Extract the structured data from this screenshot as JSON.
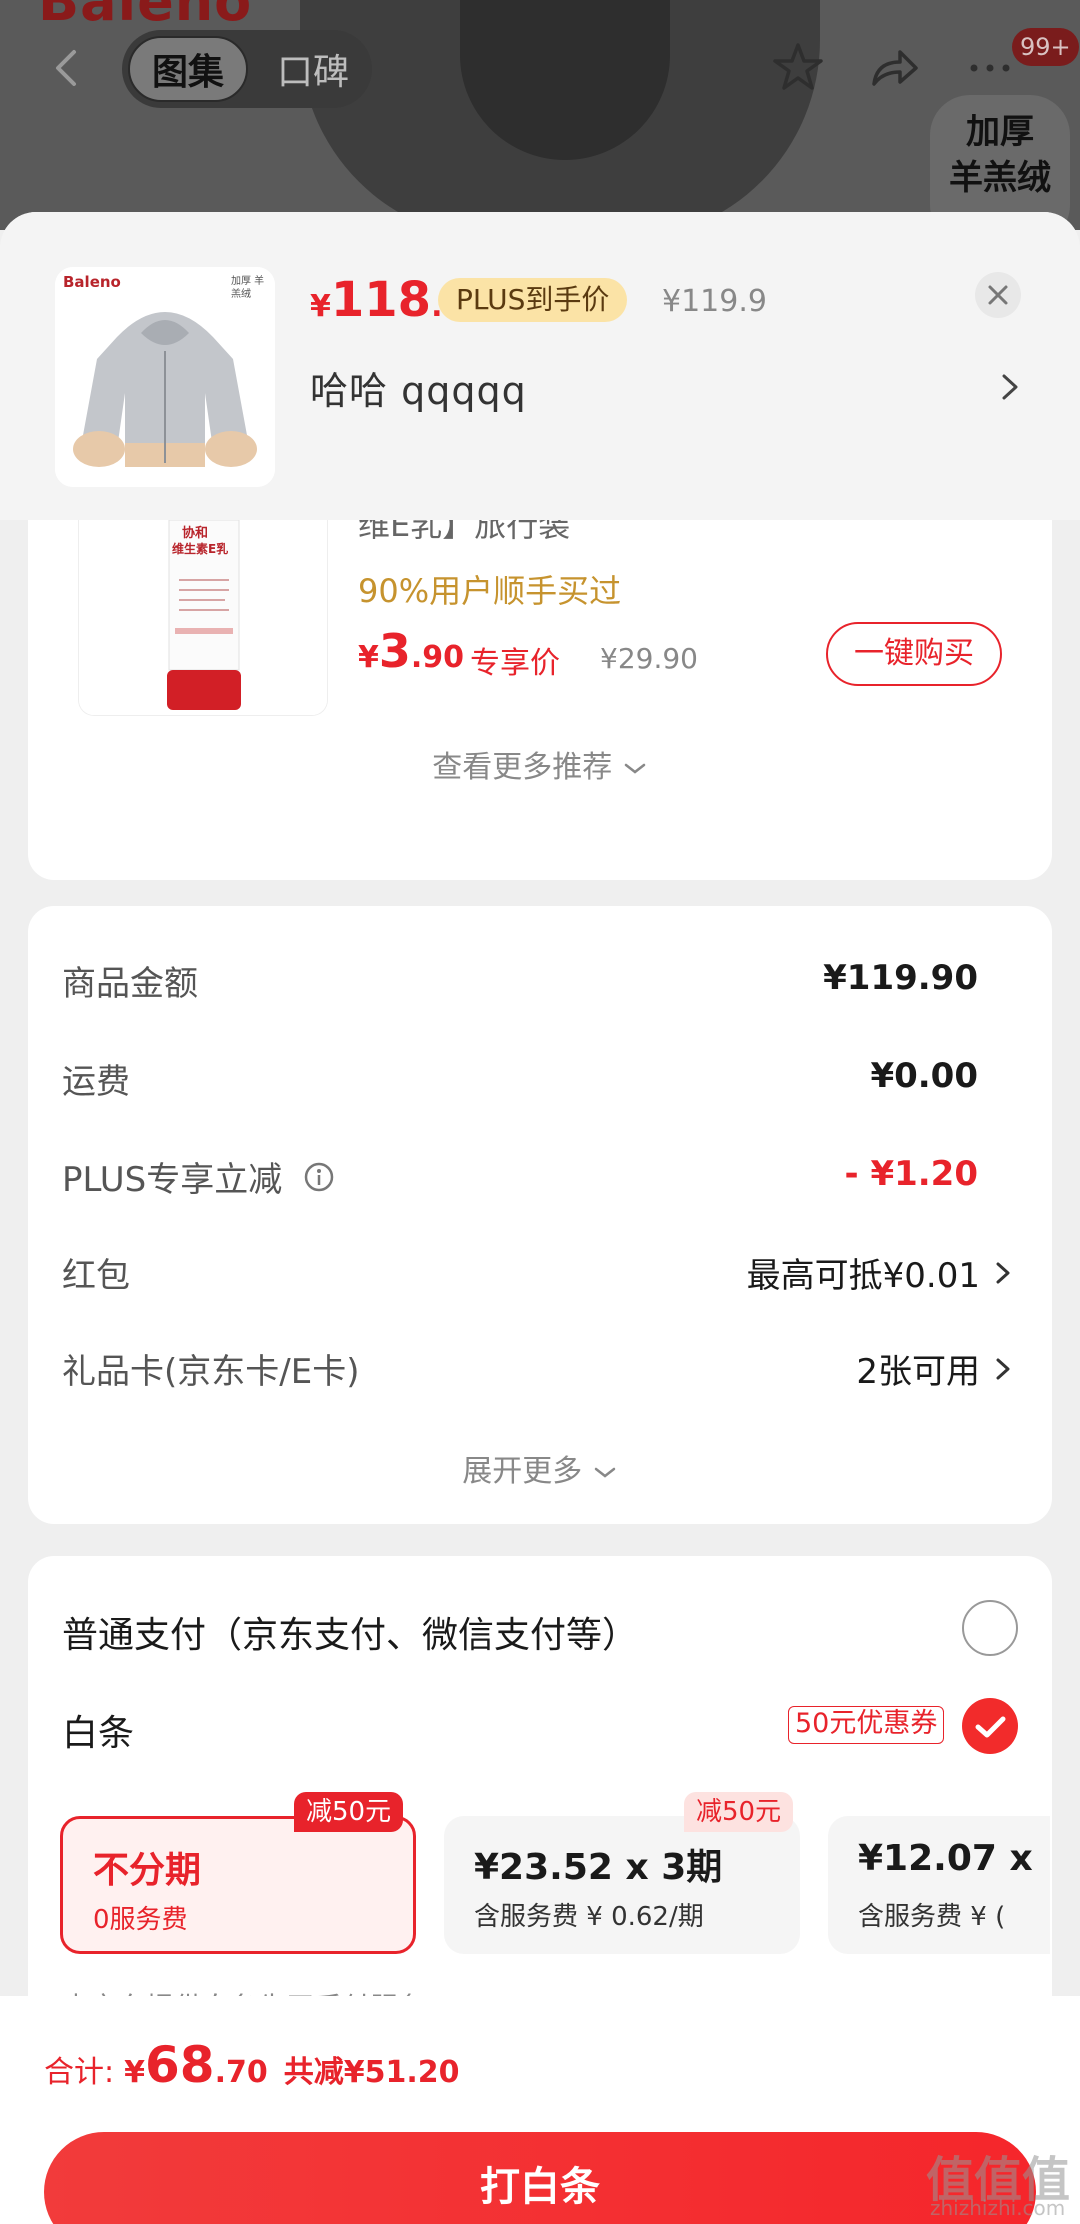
{
  "top_bar": {
    "brand_text": "Baleno",
    "tab_gallery": "图集",
    "tab_reviews": "口碑",
    "badge_count": "99+",
    "promo_line1": "加厚",
    "promo_line2": "羊羔绒"
  },
  "product": {
    "thumb_brand": "Baleno",
    "thumb_tag": "加厚 羊羔绒",
    "price_symbol": "¥",
    "price_int": "118",
    "price_dec": ".7",
    "plus_label": "PLUS到手价",
    "original_price": "¥119.9",
    "sku": "哈哈   qqqqq"
  },
  "recommend": {
    "title": "维E乳】旅行装",
    "stat": "90%用户顺手买过",
    "price_symbol": "¥",
    "price_int": "3",
    "price_dec": ".90",
    "price_label": "专享价",
    "original_price": "¥29.90",
    "buy_label": "一键购买",
    "more_label": "查看更多推荐",
    "tube_brand": "协和",
    "tube_name": "维生素E乳"
  },
  "costs": {
    "rows": [
      {
        "label": "商品金额",
        "value": "¥119.90"
      },
      {
        "label": "运费",
        "value": "¥0.00"
      },
      {
        "label": "PLUS专享立减",
        "value": "- ¥1.20"
      }
    ],
    "hongbao_label": "红包",
    "hongbao_value": "最高可抵¥0.01",
    "giftcard_label": "礼品卡(京东卡/E卡)",
    "giftcard_value": "2张可用",
    "expand_label": "展开更多"
  },
  "payment": {
    "normal_label": "普通支付（京东支付、微信支付等）",
    "baitiao_label": "白条",
    "coupon_tag": "50元优惠券",
    "plans": [
      {
        "title": "不分期",
        "sub": "0服务费",
        "tag": "减50元",
        "selected": true
      },
      {
        "title": "¥23.52 x 3期",
        "sub": "含服务费 ¥ 0.62/期",
        "tag": "减50元",
        "selected": false
      },
      {
        "title": "¥12.07 x",
        "sub": "含服务费 ¥ (",
        "tag": "",
        "selected": false
      }
    ],
    "provider_note": "由京东提供白条先买后付服务"
  },
  "footer": {
    "total_label": "合计:",
    "total_symbol": "¥",
    "total_int": "68",
    "total_dec": ".70",
    "saved": "共减¥51.20",
    "pay_button": "打白条"
  },
  "watermark": {
    "main": "值值值",
    "sub": "zhizhizhi.com"
  },
  "colors": {
    "accent": "#e8232b",
    "plus_tag_bg": "#fbe3a6",
    "stat_gold": "#c6932e"
  }
}
